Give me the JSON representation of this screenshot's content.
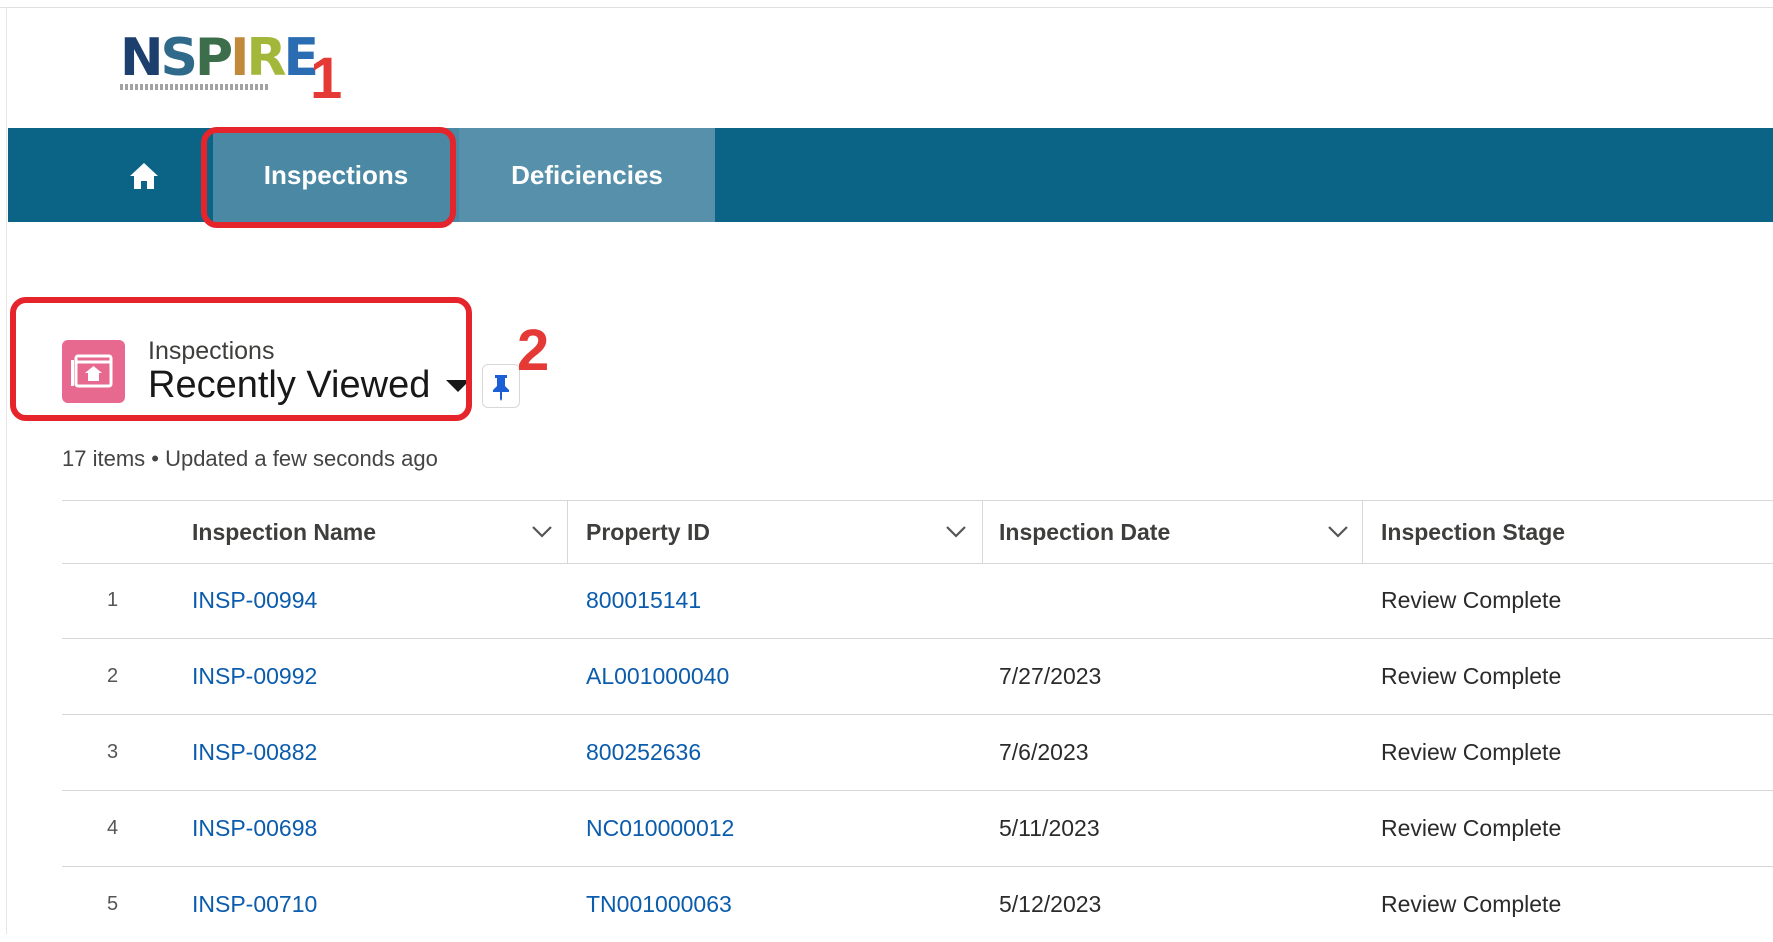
{
  "logo": {
    "text_letters": [
      "N",
      "S",
      "P",
      "I",
      "R",
      "E"
    ]
  },
  "callouts": {
    "first": "1",
    "second": "2"
  },
  "nav": {
    "home_icon": "home-icon",
    "tabs": [
      {
        "label": "Inspections"
      },
      {
        "label": "Deficiencies"
      }
    ]
  },
  "list_header": {
    "object_label": "Inspections",
    "view_name": "Recently Viewed",
    "status": "17 items • Updated a few seconds ago",
    "icon_color": "#e8698f"
  },
  "table": {
    "columns": [
      "Inspection Name",
      "Property ID",
      "Inspection Date",
      "Inspection Stage"
    ],
    "rows": [
      {
        "num": "1",
        "name": "INSP-00994",
        "property_id": "800015141",
        "date": "",
        "stage": "Review Complete"
      },
      {
        "num": "2",
        "name": "INSP-00992",
        "property_id": "AL001000040",
        "date": "7/27/2023",
        "stage": "Review Complete"
      },
      {
        "num": "3",
        "name": "INSP-00882",
        "property_id": "800252636",
        "date": "7/6/2023",
        "stage": "Review Complete"
      },
      {
        "num": "4",
        "name": "INSP-00698",
        "property_id": "NC010000012",
        "date": "5/11/2023",
        "stage": "Review Complete"
      },
      {
        "num": "5",
        "name": "INSP-00710",
        "property_id": "TN001000063",
        "date": "5/12/2023",
        "stage": "Review Complete"
      }
    ]
  },
  "colors": {
    "nav_bg": "#0b6386",
    "active_tab": "#4a88a4",
    "link": "#0b5cad",
    "callout": "#e53935"
  }
}
